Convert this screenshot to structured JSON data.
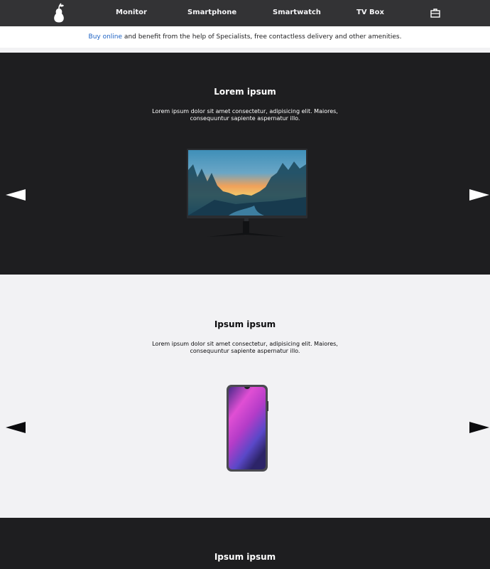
{
  "nav": {
    "logo_icon": "pear-logo-icon",
    "links": [
      "Monitor",
      "Smartphone",
      "Smartwatch",
      "TV Box"
    ],
    "bag_icon": "shopping-bag-icon"
  },
  "promo": {
    "link_text": "Buy online",
    "rest_text": " and benefit from the help of Specialists, free contactless delivery and other amenities."
  },
  "sections": [
    {
      "theme": "dark",
      "title": "Lorem ipsum",
      "text": "Lorem ipsum dolor sit amet consectetur, adipisicing elit. Maiores, consequuntur sapiente aspernatur illo.",
      "image": "monitor-image"
    },
    {
      "theme": "light",
      "title": "Ipsum ipsum",
      "text": "Lorem ipsum dolor sit amet consectetur, adipisicing elit. Maiores, consequuntur sapiente aspernatur illo.",
      "image": "smartphone-image"
    },
    {
      "theme": "dark",
      "title": "Ipsum ipsum"
    }
  ],
  "colors": {
    "nav_bg": "#333335",
    "dark_bg": "#1e1e20",
    "light_bg": "#f2f2f4",
    "link": "#1d62c4"
  }
}
